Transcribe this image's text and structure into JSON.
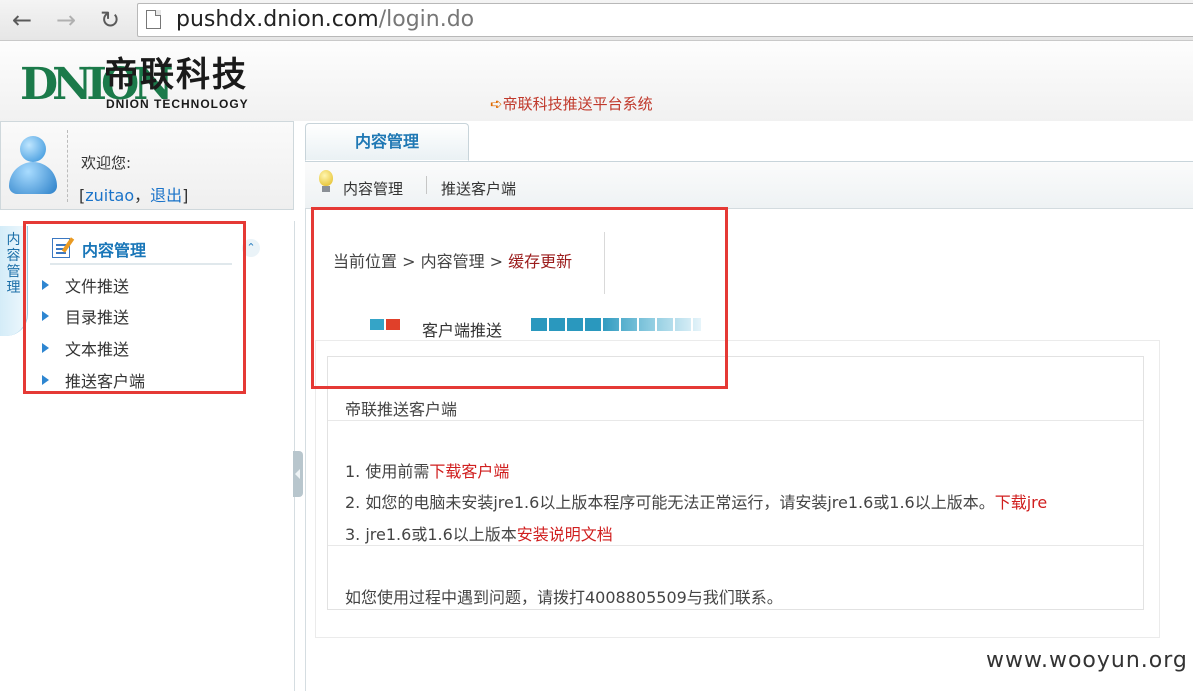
{
  "browser": {
    "back_icon": "arrow-left",
    "forward_icon": "arrow-right",
    "reload_icon": "reload",
    "url_host": "pushdx.dnion.com",
    "url_path": "/login.do"
  },
  "header": {
    "logo_mark": "DNION",
    "logo_cn": "帝联科技",
    "logo_en": "DNION TECHNOLOGY",
    "system_title": "帝联科技推送平台系统",
    "system_title_arrow": "➪"
  },
  "user": {
    "welcome": "欢迎您:",
    "bracket_open": "[",
    "username": "zuitao",
    "comma": "，",
    "logout": "退出",
    "bracket_close": "]"
  },
  "sidebar": {
    "side_tab": [
      "内",
      "容",
      "管",
      "理"
    ],
    "menu_title": "内容管理",
    "items": [
      {
        "label": "文件推送"
      },
      {
        "label": "目录推送"
      },
      {
        "label": "文本推送"
      },
      {
        "label": "推送客户端"
      }
    ]
  },
  "main": {
    "tab_label": "内容管理",
    "crumb_a": "内容管理",
    "crumb_b": "推送客户端",
    "location_prefix": "当前位置 > 内容管理 > ",
    "location_current": "缓存更新",
    "section_title": "客户端推送",
    "box_title": "帝联推送客户端",
    "line1_prefix": "1. 使用前需",
    "line1_link": "下载客户端",
    "line2_prefix": "2. 如您的电脑未安装jre1.6以上版本程序可能无法正常运行，请安装jre1.6或1.6以上版本。",
    "line2_link": "下载jre",
    "line3_prefix": "3. jre1.6或1.6以上版本",
    "line3_link": "安装说明文档",
    "contact": "如您使用过程中遇到问题，请拨打4008805509与我们联系。"
  },
  "colors": {
    "accent_blue": "#1976b8",
    "link_red": "#d01f1f",
    "highlight_red": "#e53935"
  },
  "watermark": "www.wooyun.org"
}
